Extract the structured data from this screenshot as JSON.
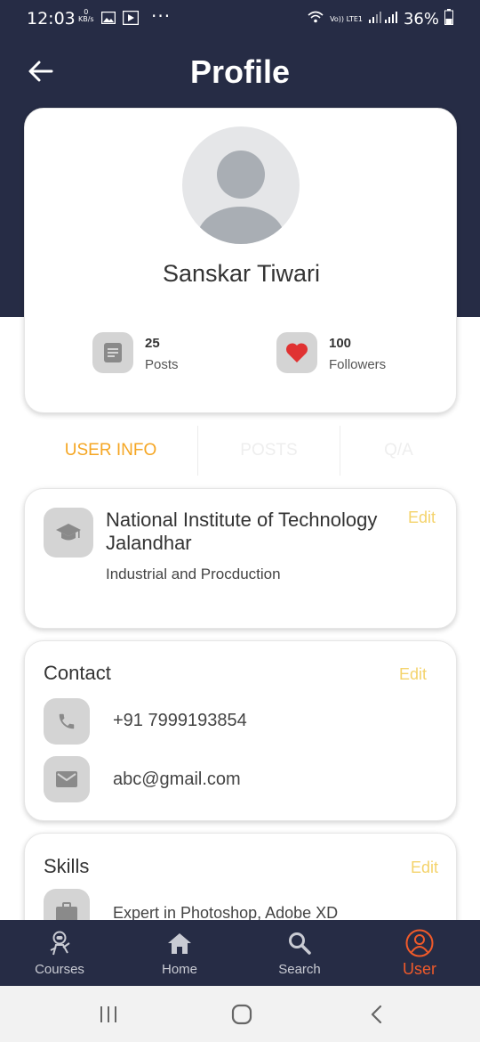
{
  "status_bar": {
    "time": "12:03",
    "data_speed_value": "0",
    "data_speed_unit": "KB/s",
    "more": "···",
    "network_label": "Vo)) LTE1",
    "battery": "36%"
  },
  "header": {
    "title": "Profile"
  },
  "profile": {
    "name": "Sanskar Tiwari",
    "stats": [
      {
        "value": "25",
        "label": "Posts",
        "icon": "document-icon"
      },
      {
        "value": "100",
        "label": "Followers",
        "icon": "heart-icon"
      }
    ]
  },
  "tabs": [
    {
      "label": "USER INFO",
      "active": true
    },
    {
      "label": "POSTS",
      "active": false
    },
    {
      "label": "Q/A",
      "active": false
    }
  ],
  "education": {
    "institute": "National Institute of Technology Jalandhar",
    "branch": "Industrial and Procduction",
    "edit_label": "Edit"
  },
  "contact": {
    "title": "Contact",
    "edit_label": "Edit",
    "phone": "+91 7999193854",
    "email": "abc@gmail.com"
  },
  "skills": {
    "title": "Skills",
    "edit_label": "Edit",
    "first_skill": "Expert in Photoshop, Adobe XD"
  },
  "bottom_nav": [
    {
      "label": "Courses",
      "icon": "astronaut-icon",
      "active": false
    },
    {
      "label": "Home",
      "icon": "home-icon",
      "active": false
    },
    {
      "label": "Search",
      "icon": "search-icon",
      "active": false
    },
    {
      "label": "User",
      "icon": "user-icon",
      "active": true
    }
  ],
  "colors": {
    "header_bg": "#262c45",
    "active_tab": "#f5a623",
    "edit_link": "#f4d36b",
    "active_nav": "#f05a2a",
    "heart": "#e03232"
  }
}
